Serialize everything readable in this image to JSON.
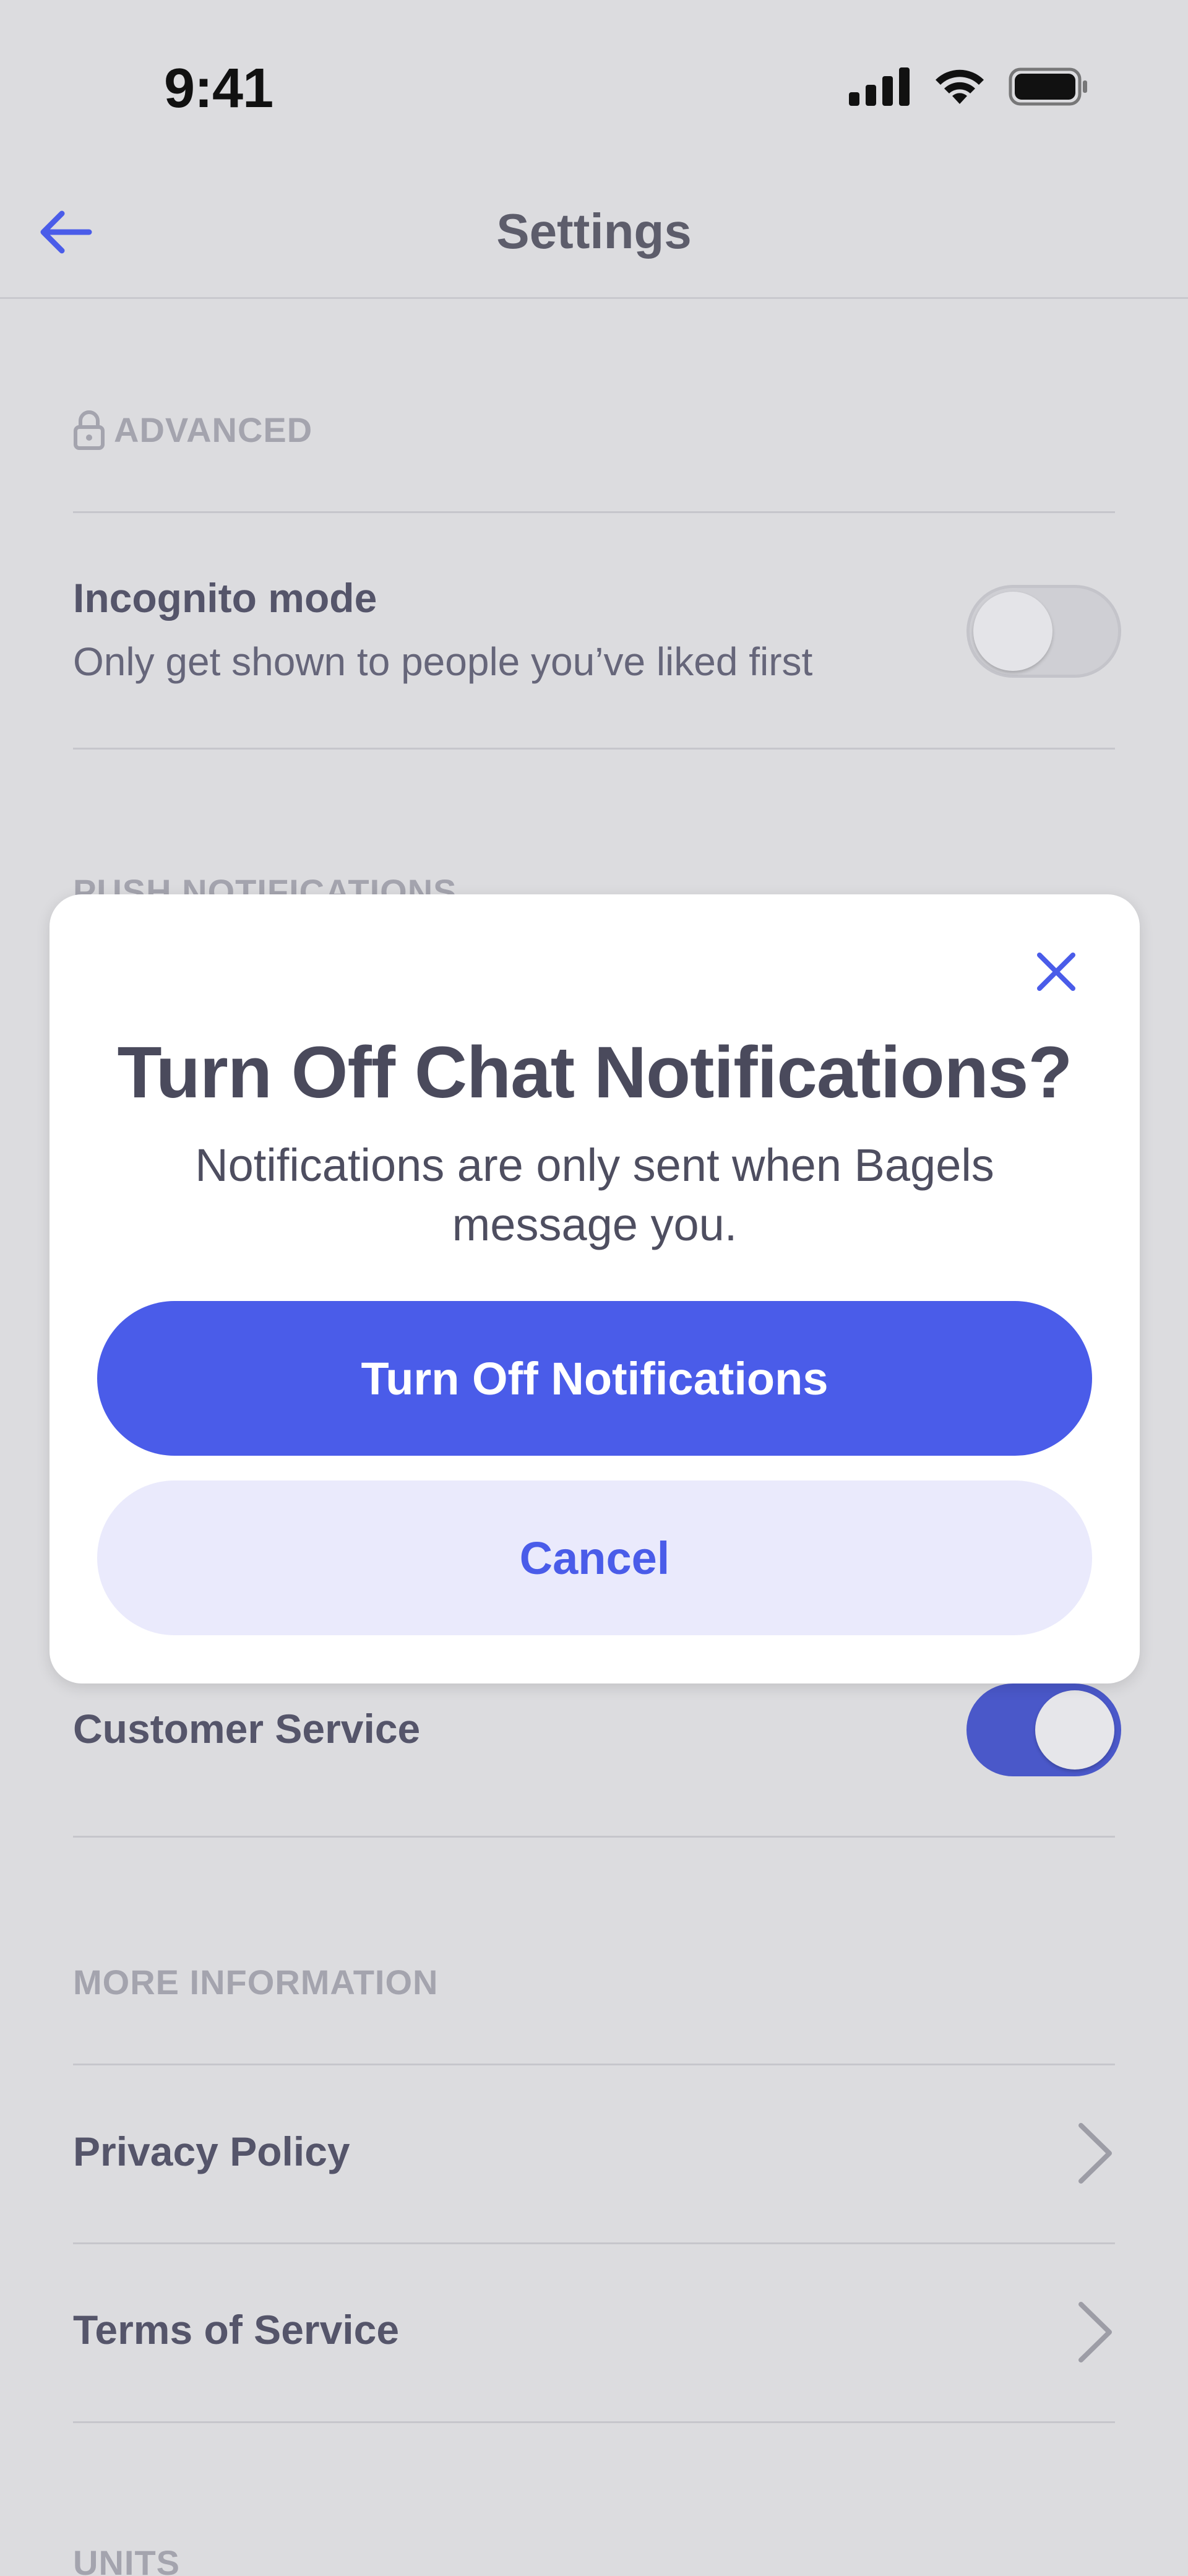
{
  "status_bar": {
    "time": "9:41",
    "icons": [
      "cellular-signal-icon",
      "wifi-icon",
      "battery-icon"
    ]
  },
  "nav": {
    "title": "Settings",
    "back_icon": "arrow-left-icon"
  },
  "sections": {
    "advanced": {
      "header": "ADVANCED",
      "icon": "lock-icon",
      "incognito": {
        "title": "Incognito mode",
        "subtitle": "Only get shown to people you’ve liked first",
        "enabled": false
      }
    },
    "push_notifications": {
      "header": "PUSH NOTIFICATIONS",
      "customer_service": {
        "title": "Customer Service",
        "enabled": true
      }
    },
    "more_information": {
      "header": "MORE INFORMATION",
      "items": [
        {
          "label": "Privacy Policy"
        },
        {
          "label": "Terms of Service"
        }
      ]
    },
    "units": {
      "header": "UNITS"
    }
  },
  "modal": {
    "title": "Turn Off Chat Notifications?",
    "body": "Notifications are only sent when Bagels message you.",
    "primary_label": "Turn Off Notifications",
    "secondary_label": "Cancel",
    "close_icon": "close-icon"
  },
  "colors": {
    "accent": "#4a5ce9",
    "background": "#dcdcdf",
    "toggle_on": "#4a58c9"
  }
}
